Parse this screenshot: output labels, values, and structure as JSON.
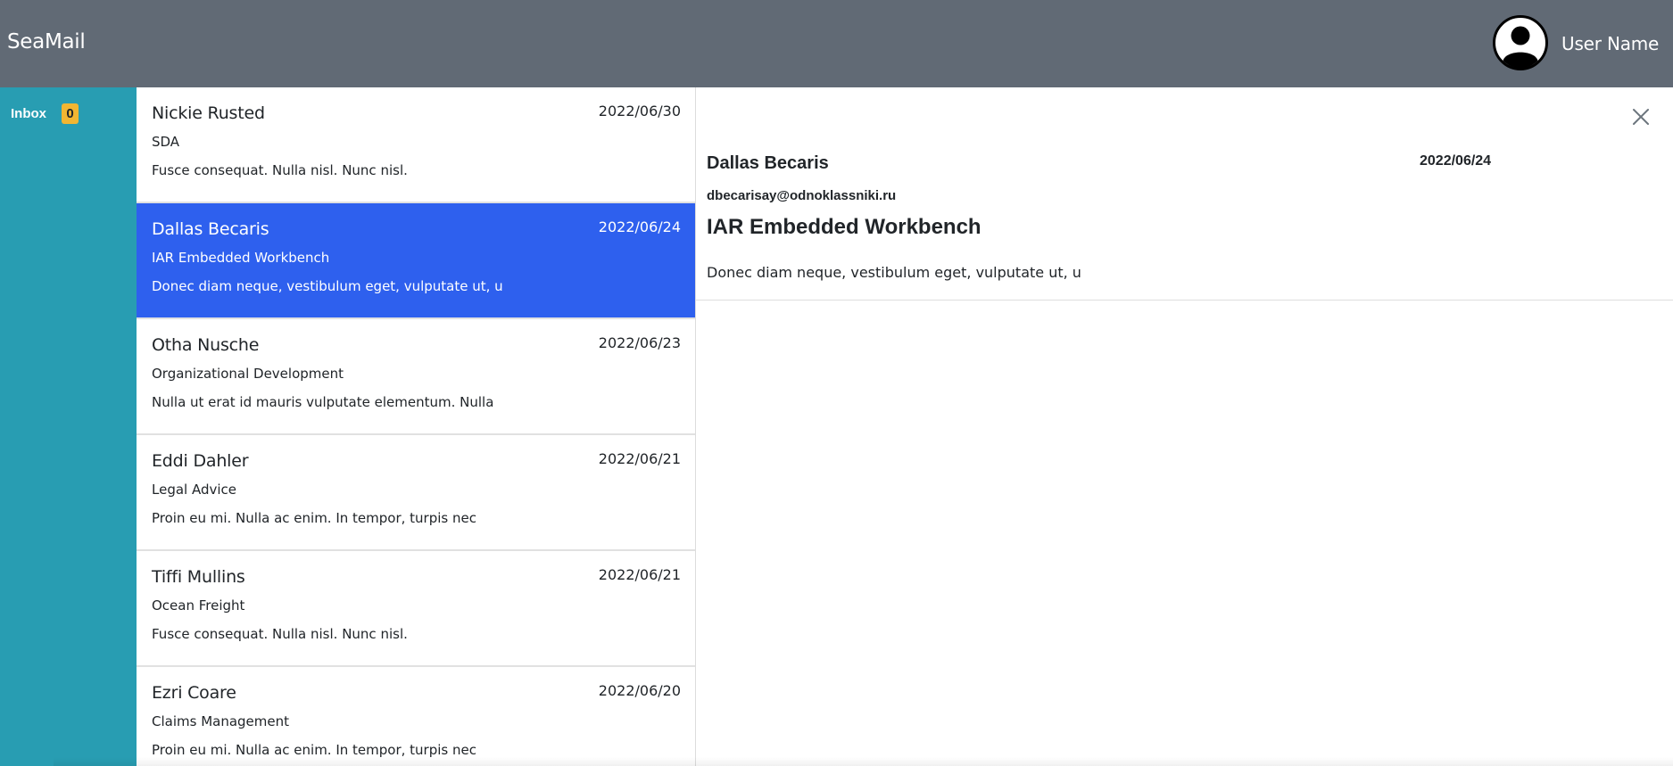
{
  "app": {
    "title": "SeaMail"
  },
  "user": {
    "name": "User Name",
    "avatar_icon": "user-circle-icon"
  },
  "sidebar": {
    "items": [
      {
        "label": "Inbox",
        "count": "0"
      }
    ]
  },
  "mail_list": [
    {
      "from": "Nickie Rusted",
      "date": "2022/06/30",
      "subject": "SDA",
      "preview": "Fusce consequat. Nulla nisl. Nunc nisl."
    },
    {
      "from": "Dallas Becaris",
      "date": "2022/06/24",
      "subject": "IAR Embedded Workbench",
      "preview": "Donec diam neque, vestibulum eget, vulputate ut, u"
    },
    {
      "from": "Otha Nusche",
      "date": "2022/06/23",
      "subject": "Organizational Development",
      "preview": "Nulla ut erat id mauris vulputate elementum. Nulla"
    },
    {
      "from": "Eddi Dahler",
      "date": "2022/06/21",
      "subject": "Legal Advice",
      "preview": "Proin eu mi. Nulla ac enim. In tempor, turpis nec"
    },
    {
      "from": "Tiffi Mullins",
      "date": "2022/06/21",
      "subject": "Ocean Freight",
      "preview": "Fusce consequat. Nulla nisl. Nunc nisl."
    },
    {
      "from": "Ezri Coare",
      "date": "2022/06/20",
      "subject": "Claims Management",
      "preview": "Proin eu mi. Nulla ac enim. In tempor, turpis nec"
    }
  ],
  "reader": {
    "from": "Dallas Becaris",
    "date": "2022/06/24",
    "email": "dbecarisay@odnoklassniki.ru",
    "subject": "IAR Embedded Workbench",
    "body": "Donec diam neque, vestibulum eget, vulputate ut, u",
    "close_icon": "close-icon"
  },
  "colors": {
    "topbar": "#616a75",
    "sidebar": "#289db2",
    "selected": "#2e60ee",
    "badge": "#f2b632"
  }
}
